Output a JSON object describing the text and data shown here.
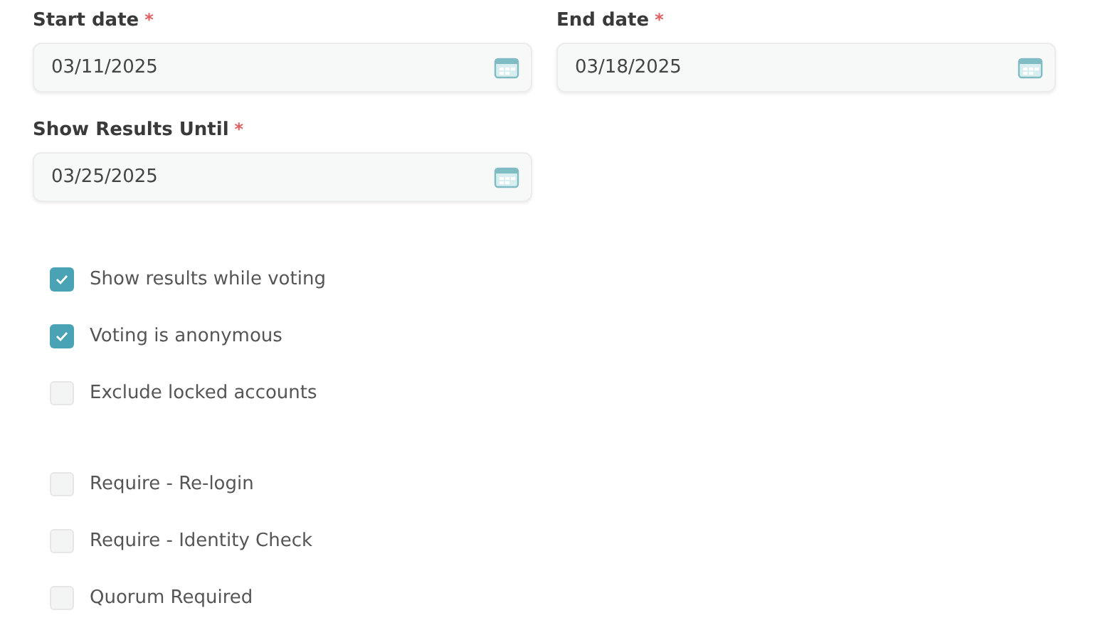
{
  "date_fields": [
    {
      "label": "Start date",
      "required_mark": "*",
      "value": "03/11/2025"
    },
    {
      "label": "End date",
      "required_mark": "*",
      "value": "03/18/2025"
    },
    {
      "label": "Show Results Until",
      "required_mark": "*",
      "value": "03/25/2025"
    }
  ],
  "checkbox_groups": [
    [
      {
        "label": "Show results while voting",
        "checked": true
      },
      {
        "label": "Voting is anonymous",
        "checked": true
      },
      {
        "label": "Exclude locked accounts",
        "checked": false
      }
    ],
    [
      {
        "label": "Require - Re-login",
        "checked": false
      },
      {
        "label": "Require - Identity Check",
        "checked": false
      },
      {
        "label": "Quorum Required",
        "checked": false
      }
    ]
  ]
}
